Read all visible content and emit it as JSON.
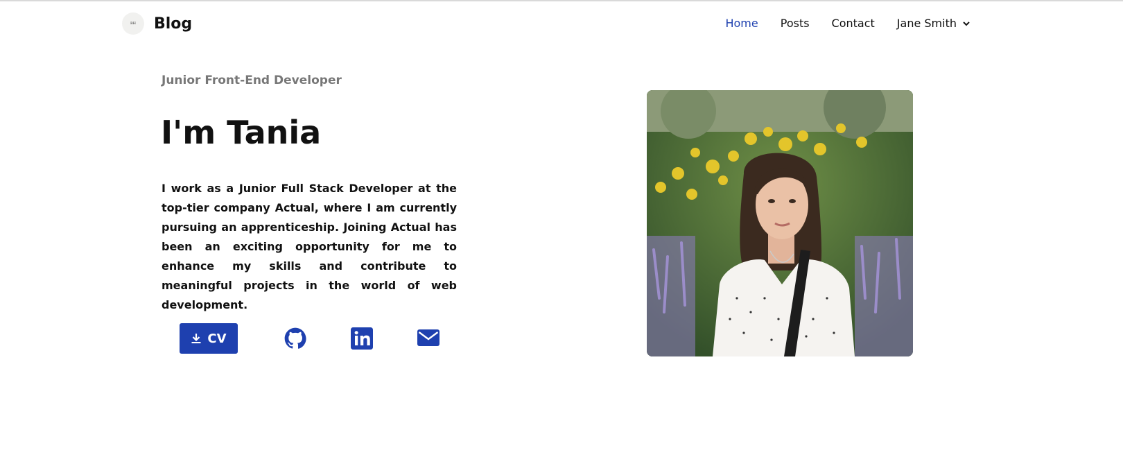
{
  "brand": {
    "logo_text": "BH",
    "name": "Blog"
  },
  "nav": {
    "items": [
      {
        "label": "Home",
        "active": true
      },
      {
        "label": "Posts",
        "active": false
      },
      {
        "label": "Contact",
        "active": false
      }
    ],
    "user": {
      "name": "Jane Smith",
      "icon": "chevron-down-icon"
    }
  },
  "hero": {
    "subtitle": "Junior Front-End Developer",
    "title": "I'm Tania",
    "bio": "I work as a Junior Full Stack Developer at the top-tier company Actual, where I am currently pursuing an apprenticeship. Joining Actual has been an exciting opportunity for me to enhance my skills and contribute to meaningful projects in the world of web development.",
    "cv_button": {
      "label": "CV",
      "icon": "download-icon"
    },
    "socials": [
      {
        "name": "github",
        "icon": "github-icon"
      },
      {
        "name": "linkedin",
        "icon": "linkedin-icon"
      },
      {
        "name": "email",
        "icon": "mail-icon"
      }
    ],
    "photo": {
      "subject": "portrait"
    }
  },
  "colors": {
    "accent": "#1e40af",
    "muted_text": "#777777",
    "text": "#111111"
  }
}
